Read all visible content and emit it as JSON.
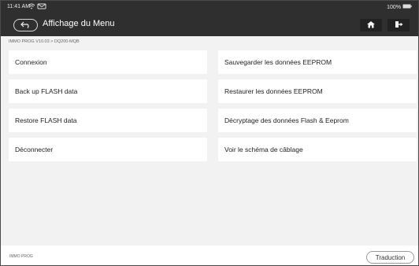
{
  "status": {
    "time": "11:41 AM",
    "battery": "100%"
  },
  "header": {
    "title": "Affichage du Menu",
    "back_icon": "back-arrow-icon",
    "home_icon": "home-icon",
    "exit_icon": "exit-icon"
  },
  "breadcrumb": "IMMO PROG V10.03 > DQ200-MQB",
  "menu": {
    "left": [
      "Connexion",
      "Back up FLASH data",
      "Restore FLASH data",
      "Déconnecter"
    ],
    "right": [
      "Sauvegarder les données EEPROM",
      "Restaurer les données EEPROM",
      "Décryptage des données Flash & Eeprom",
      "Voir le schéma de câblage"
    ]
  },
  "footer": {
    "left_label": "IMMO PROG",
    "translate_button": "Traduction"
  },
  "colors": {
    "header_bg": "#2f2f2f",
    "content_bg": "#f2f2f2",
    "item_bg": "#ffffff"
  }
}
